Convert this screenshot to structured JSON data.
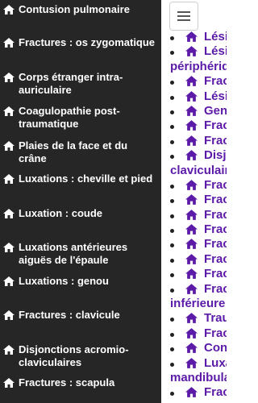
{
  "drawer": {
    "items": [
      {
        "label": "Contusion pulmonaire"
      },
      {
        "label": "Fractures : os zygomatique"
      },
      {
        "label": "Corps étranger intra-auriculaire"
      },
      {
        "label": "Coagulopathie post-traumatique"
      },
      {
        "label": "Plaies de la face et du crâne"
      },
      {
        "label": "Luxations : cheville et pied"
      },
      {
        "label": "Luxation : coude"
      },
      {
        "label": "Luxations antérieures aiguës de l'épaule"
      },
      {
        "label": "Luxations : genou"
      },
      {
        "label": "Fractures : clavicule"
      },
      {
        "label": "Disjonctions acromio-claviculaires"
      },
      {
        "label": "Fractures : scapula"
      }
    ]
  },
  "content": {
    "lines": [
      {
        "text": "Lési",
        "bullet": true
      },
      {
        "text": "Lési",
        "bullet": true
      },
      {
        "text": "périphériqu",
        "bullet": false
      },
      {
        "text": "Frac",
        "bullet": true
      },
      {
        "text": "Lési",
        "bullet": true
      },
      {
        "text": "Gen",
        "bullet": true
      },
      {
        "text": "Frac",
        "bullet": true
      },
      {
        "text": "Frac",
        "bullet": true
      },
      {
        "text": "Disj",
        "bullet": true
      },
      {
        "text": "claviculaire",
        "bullet": false
      },
      {
        "text": "Frac",
        "bullet": true
      },
      {
        "text": "Frac",
        "bullet": true
      },
      {
        "text": "Frac",
        "bullet": true
      },
      {
        "text": "Frac",
        "bullet": true
      },
      {
        "text": "Frac",
        "bullet": true
      },
      {
        "text": "Frac",
        "bullet": true
      },
      {
        "text": "Frac",
        "bullet": true
      },
      {
        "text": "Frac",
        "bullet": true
      },
      {
        "text": "inférieure",
        "bullet": false
      },
      {
        "text": "Trau",
        "bullet": true
      },
      {
        "text": "Frac",
        "bullet": true
      },
      {
        "text": "Con",
        "bullet": true
      },
      {
        "text": "Luxa",
        "bullet": true
      },
      {
        "text": "mandibula",
        "bullet": false
      },
      {
        "text": "Frac",
        "bullet": true
      }
    ]
  },
  "colors": {
    "drawer_bg": "#262626",
    "link": "#5b1aa8",
    "drawer_text": "#ffffff"
  },
  "icons": {
    "drawer_item": "home-icon",
    "menu": "hamburger-icon"
  }
}
